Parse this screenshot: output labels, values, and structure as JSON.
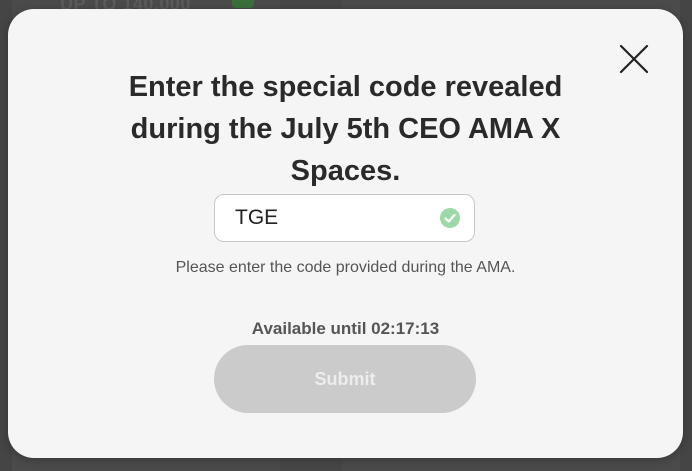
{
  "background": {
    "banner_text": "UP TO 140,000"
  },
  "modal": {
    "title": "Enter the special code revealed during the July 5th CEO AMA X Spaces.",
    "code_input": {
      "value": "TGE",
      "valid": true
    },
    "helper_text": "Please enter the code provided during the AMA.",
    "availability": "Available until 02:17:13",
    "submit_label": "Submit",
    "submit_disabled": true
  },
  "colors": {
    "modal_bg": "#f5f5f5",
    "title": "#2a2a2a",
    "valid_check": "#9fd8a8",
    "submit_disabled_bg": "#cbcbcb"
  },
  "icons": {
    "close": "close-icon",
    "valid": "check-circle-icon"
  }
}
